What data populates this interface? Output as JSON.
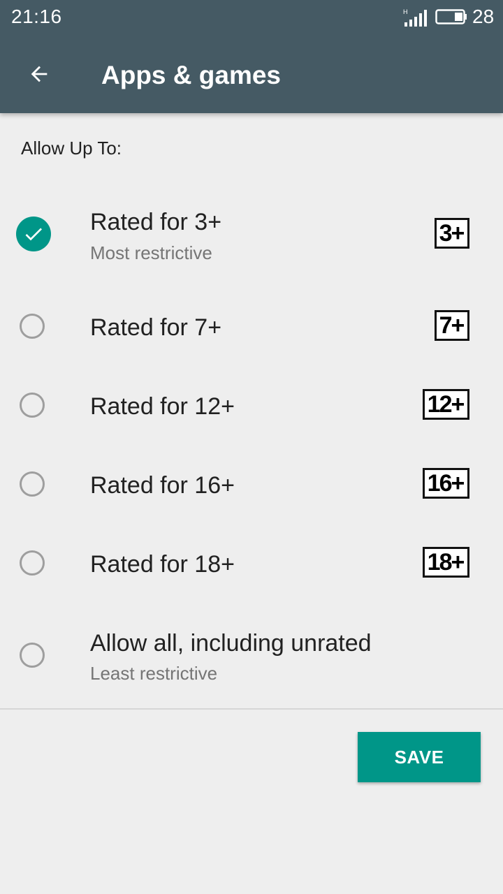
{
  "status_bar": {
    "time": "21:16",
    "network_type": "H",
    "battery_level": "28",
    "signal_icon": "signal-icon",
    "battery_icon": "battery-icon"
  },
  "toolbar": {
    "back_icon": "arrow-back-icon",
    "title": "Apps & games"
  },
  "content": {
    "section_label": "Allow Up To:",
    "options": [
      {
        "title": "Rated for 3+",
        "subtitle": "Most restrictive",
        "badge": "3+",
        "selected": true
      },
      {
        "title": "Rated for 7+",
        "subtitle": "",
        "badge": "7+",
        "selected": false
      },
      {
        "title": "Rated for 12+",
        "subtitle": "",
        "badge": "12+",
        "selected": false
      },
      {
        "title": "Rated for 16+",
        "subtitle": "",
        "badge": "16+",
        "selected": false
      },
      {
        "title": "Rated for 18+",
        "subtitle": "",
        "badge": "18+",
        "selected": false
      },
      {
        "title": "Allow all, including unrated",
        "subtitle": "Least restrictive",
        "badge": "",
        "selected": false
      }
    ]
  },
  "actions": {
    "save_label": "SAVE"
  },
  "colors": {
    "appbar": "#455a64",
    "accent": "#009688",
    "background": "#eeeeee"
  }
}
